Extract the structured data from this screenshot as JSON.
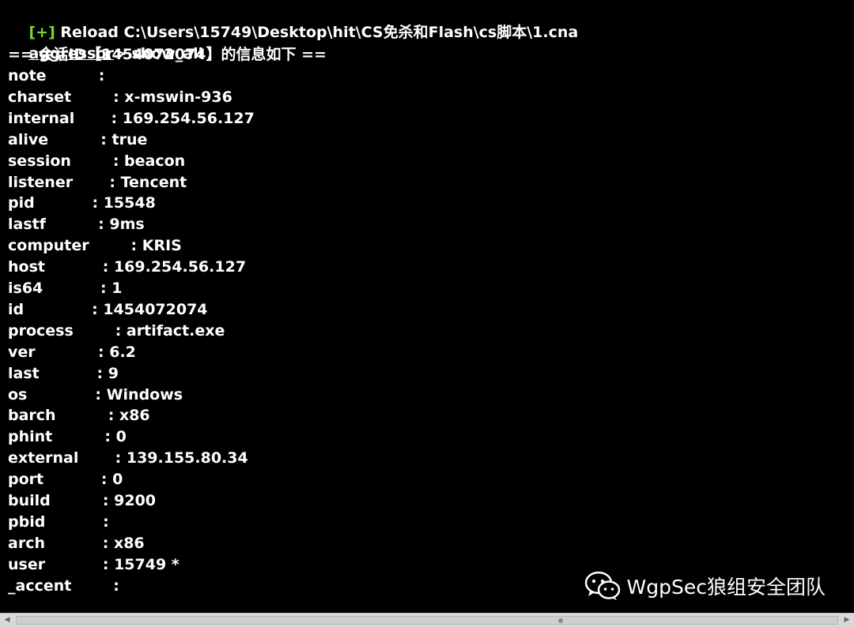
{
  "header": {
    "reload_tag": "[+]",
    "reload_text": " Reload C:\\Users\\15749\\Desktop\\hit\\CS免杀和Flash\\cs脚本\\1.cna",
    "prompt_name": "aggressor",
    "prompt_command": "> show_all",
    "info_banner": "== 会话ID【1454072074】的信息如下 =="
  },
  "fields": [
    {
      "key": "note",
      "sep": "          :"
    },
    {
      "key": "charset",
      "sep": "        : x-mswin-936"
    },
    {
      "key": "internal",
      "sep": "       : 169.254.56.127"
    },
    {
      "key": "alive",
      "sep": "          : true"
    },
    {
      "key": "session",
      "sep": "        : beacon"
    },
    {
      "key": "listener",
      "sep": "       : Tencent"
    },
    {
      "key": "pid",
      "sep": "           : 15548"
    },
    {
      "key": "lastf",
      "sep": "          : 9ms"
    },
    {
      "key": "computer",
      "sep": "        : KRIS"
    },
    {
      "key": "host",
      "sep": "           : 169.254.56.127"
    },
    {
      "key": "is64",
      "sep": "           : 1"
    },
    {
      "key": "id",
      "sep": "             : 1454072074"
    },
    {
      "key": "process",
      "sep": "        : artifact.exe"
    },
    {
      "key": "ver",
      "sep": "            : 6.2"
    },
    {
      "key": "last",
      "sep": "           : 9"
    },
    {
      "key": "os",
      "sep": "             : Windows"
    },
    {
      "key": "barch",
      "sep": "          : x86"
    },
    {
      "key": "phint",
      "sep": "          : 0"
    },
    {
      "key": "external",
      "sep": "       : 139.155.80.34"
    },
    {
      "key": "port",
      "sep": "           : 0"
    },
    {
      "key": "build",
      "sep": "          : 9200"
    },
    {
      "key": "pbid",
      "sep": "           :"
    },
    {
      "key": "arch",
      "sep": "           : x86"
    },
    {
      "key": "user",
      "sep": "           : 15749 *"
    },
    {
      "key": "_accent",
      "sep": "        :"
    }
  ],
  "watermark": {
    "icon": "wechat-icon",
    "text": "WgpSec狼组安全团队"
  },
  "colors": {
    "background": "#000000",
    "text": "#ffffff",
    "reload_tag": "#7fd43b"
  }
}
